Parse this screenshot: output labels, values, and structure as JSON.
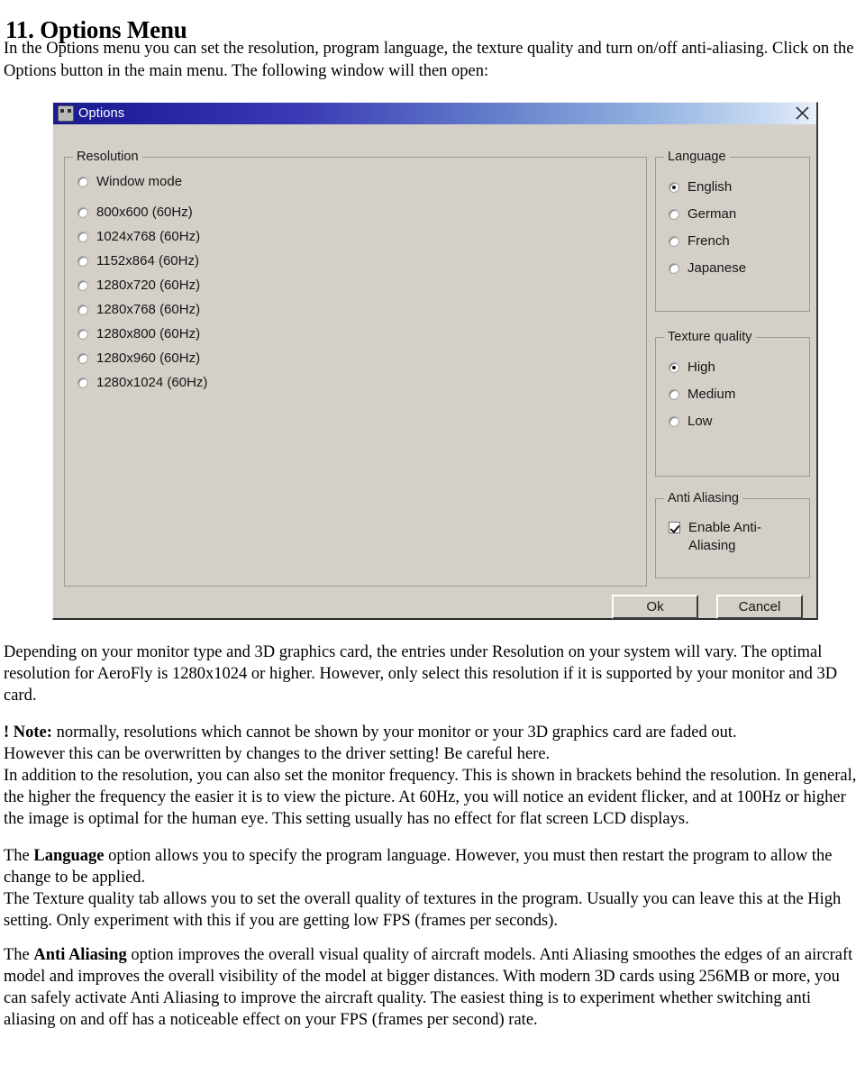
{
  "document": {
    "heading": "11. Options Menu",
    "intro": "In the Options menu you can set the resolution, program language, the texture quality and turn on/off anti-aliasing. Click on the Options button in the main menu. The following window will then open:",
    "paragraphs": {
      "p1": "Depending on your monitor type and 3D graphics card, the entries under Resolution on your system will vary. The optimal resolution for AeroFly is 1280x1024 or higher. However, only select this resolution if it is supported by your monitor and 3D card.",
      "note_label": "! Note:",
      "note_body": " normally, resolutions which cannot be shown by your monitor or your 3D graphics card are faded out.",
      "p2_line2": "However this can be overwritten by changes to the driver setting! Be careful here.",
      "p2_line3": "In addition to the resolution, you can also set the monitor frequency. This is shown in brackets behind the resolution. In general, the higher the frequency the easier it is to view the picture. At 60Hz, you will notice an evident flicker, and at 100Hz or higher the image is optimal for the human eye. This setting usually has no effect for flat screen LCD displays.",
      "p3_lead": "The ",
      "p3_bold": "Language",
      "p3_body": " option allows you to specify the program language. However, you must then restart the program to allow the change to be applied.",
      "p3_line2": "The Texture quality tab allows you to set the overall quality of textures in the program. Usually you can leave this at the High setting. Only experiment with this if you are getting low FPS (frames per seconds).",
      "p4_lead": "The ",
      "p4_bold": "Anti Aliasing",
      "p4_body": " option improves the overall visual quality of aircraft models. Anti Aliasing smoothes the edges of an aircraft model and improves the overall visibility of the model at bigger distances. With modern 3D cards using 256MB or more, you can safely activate Anti Aliasing to improve the aircraft quality. The easiest thing is to experiment whether switching anti aliasing on and off has a noticeable effect on your FPS (frames per second) rate."
    }
  },
  "dialog": {
    "title": "Options",
    "title_icon": "app-icon",
    "close_icon": "close-x-icon",
    "colors": {
      "titlebar_left": "#1b1b8f",
      "titlebar_right": "#e8f0fb",
      "face": "#d4d0c8"
    },
    "resolution": {
      "label": "Resolution",
      "options": [
        {
          "label": "Window mode",
          "selected": false
        },
        {
          "label": "800x600 (60Hz)",
          "selected": false
        },
        {
          "label": "1024x768 (60Hz)",
          "selected": false
        },
        {
          "label": "1152x864 (60Hz)",
          "selected": false
        },
        {
          "label": "1280x720 (60Hz)",
          "selected": false
        },
        {
          "label": "1280x768 (60Hz)",
          "selected": false
        },
        {
          "label": "1280x800 (60Hz)",
          "selected": false
        },
        {
          "label": "1280x960 (60Hz)",
          "selected": false
        },
        {
          "label": "1280x1024 (60Hz)",
          "selected": false
        }
      ]
    },
    "language": {
      "label": "Language",
      "options": [
        {
          "label": "English",
          "selected": true
        },
        {
          "label": "German",
          "selected": false
        },
        {
          "label": "French",
          "selected": false
        },
        {
          "label": "Japanese",
          "selected": false
        }
      ]
    },
    "texture_quality": {
      "label": "Texture quality",
      "options": [
        {
          "label": "High",
          "selected": true
        },
        {
          "label": "Medium",
          "selected": false
        },
        {
          "label": "Low",
          "selected": false
        }
      ]
    },
    "anti_aliasing": {
      "label": "Anti Aliasing",
      "checkbox_label": "Enable Anti-Aliasing",
      "checked": true
    },
    "buttons": {
      "ok": "Ok",
      "cancel": "Cancel"
    }
  }
}
